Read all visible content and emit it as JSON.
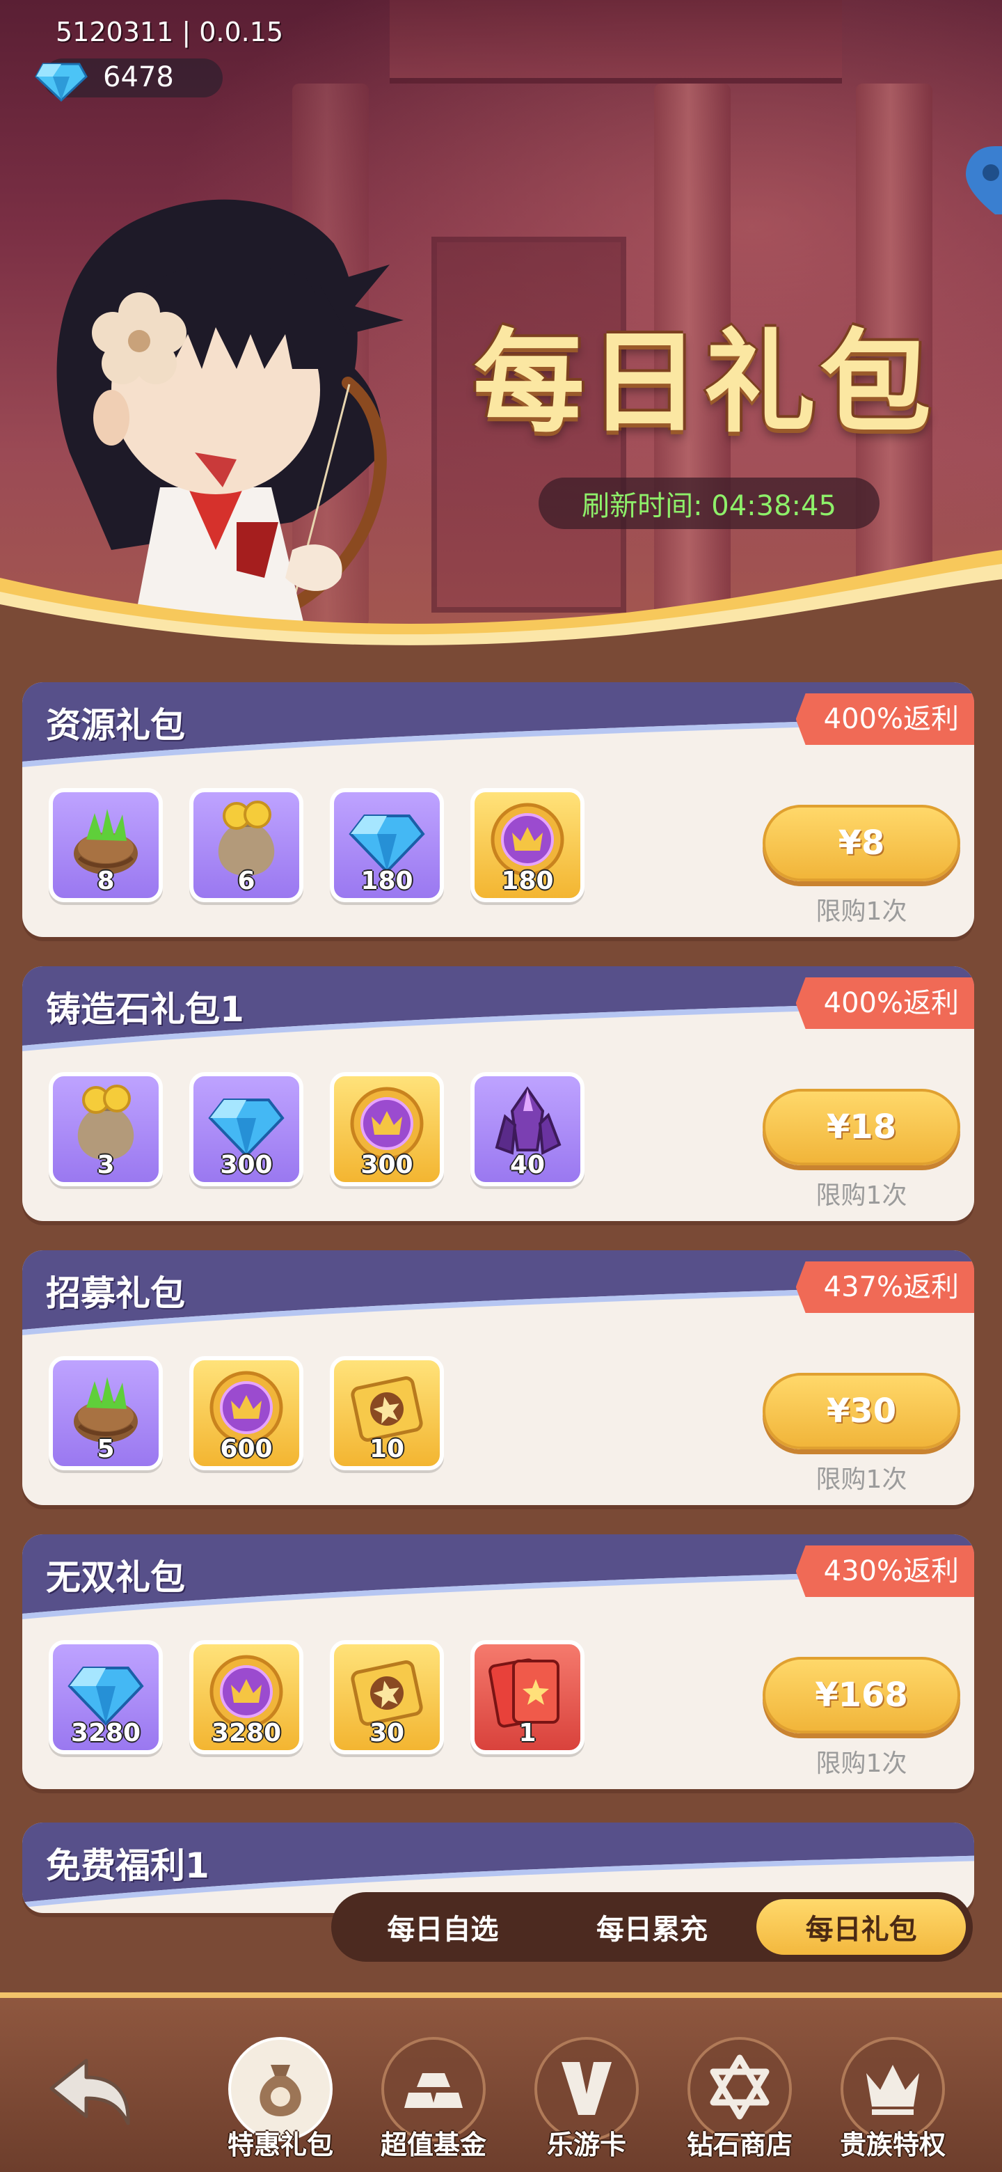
{
  "header": {
    "version": "5120311 | 0.0.15",
    "gems": "6478",
    "title": "每日礼包",
    "refresh": "刷新时间: 04:38:45"
  },
  "packs": [
    {
      "name": "资源礼包",
      "rebate": "400%返利",
      "price": "¥8",
      "limit": "限购1次",
      "items": [
        {
          "icon": "herb-bag-icon",
          "bg": "purple",
          "qty": "8"
        },
        {
          "icon": "coin-bag-icon",
          "bg": "purple",
          "qty": "6"
        },
        {
          "icon": "diamond-icon",
          "bg": "purple",
          "qty": "180"
        },
        {
          "icon": "crown-coin-icon",
          "bg": "gold",
          "qty": "180"
        }
      ]
    },
    {
      "name": "铸造石礼包1",
      "rebate": "400%返利",
      "price": "¥18",
      "limit": "限购1次",
      "items": [
        {
          "icon": "coin-bag-icon",
          "bg": "purple",
          "qty": "3"
        },
        {
          "icon": "diamond-icon",
          "bg": "purple",
          "qty": "300"
        },
        {
          "icon": "crown-coin-icon",
          "bg": "gold",
          "qty": "300"
        },
        {
          "icon": "forge-stone-icon",
          "bg": "purple",
          "qty": "40"
        }
      ]
    },
    {
      "name": "招募礼包",
      "rebate": "437%返利",
      "price": "¥30",
      "limit": "限购1次",
      "items": [
        {
          "icon": "herb-bag-icon",
          "bg": "purple",
          "qty": "5"
        },
        {
          "icon": "crown-coin-icon",
          "bg": "gold",
          "qty": "600"
        },
        {
          "icon": "star-ticket-icon",
          "bg": "gold",
          "qty": "10"
        }
      ]
    },
    {
      "name": "无双礼包",
      "rebate": "430%返利",
      "price": "¥168",
      "limit": "限购1次",
      "items": [
        {
          "icon": "diamond-icon",
          "bg": "purple",
          "qty": "3280"
        },
        {
          "icon": "crown-coin-icon",
          "bg": "gold",
          "qty": "3280"
        },
        {
          "icon": "star-ticket-icon",
          "bg": "gold",
          "qty": "30"
        },
        {
          "icon": "star-card-icon",
          "bg": "red",
          "qty": "1"
        }
      ]
    }
  ],
  "partial_pack": {
    "name": "免费福利1"
  },
  "subtabs": [
    "每日自选",
    "每日累充",
    "每日礼包"
  ],
  "nav": [
    "特惠礼包",
    "超值基金",
    "乐游卡",
    "钻石商店",
    "贵族特权"
  ]
}
